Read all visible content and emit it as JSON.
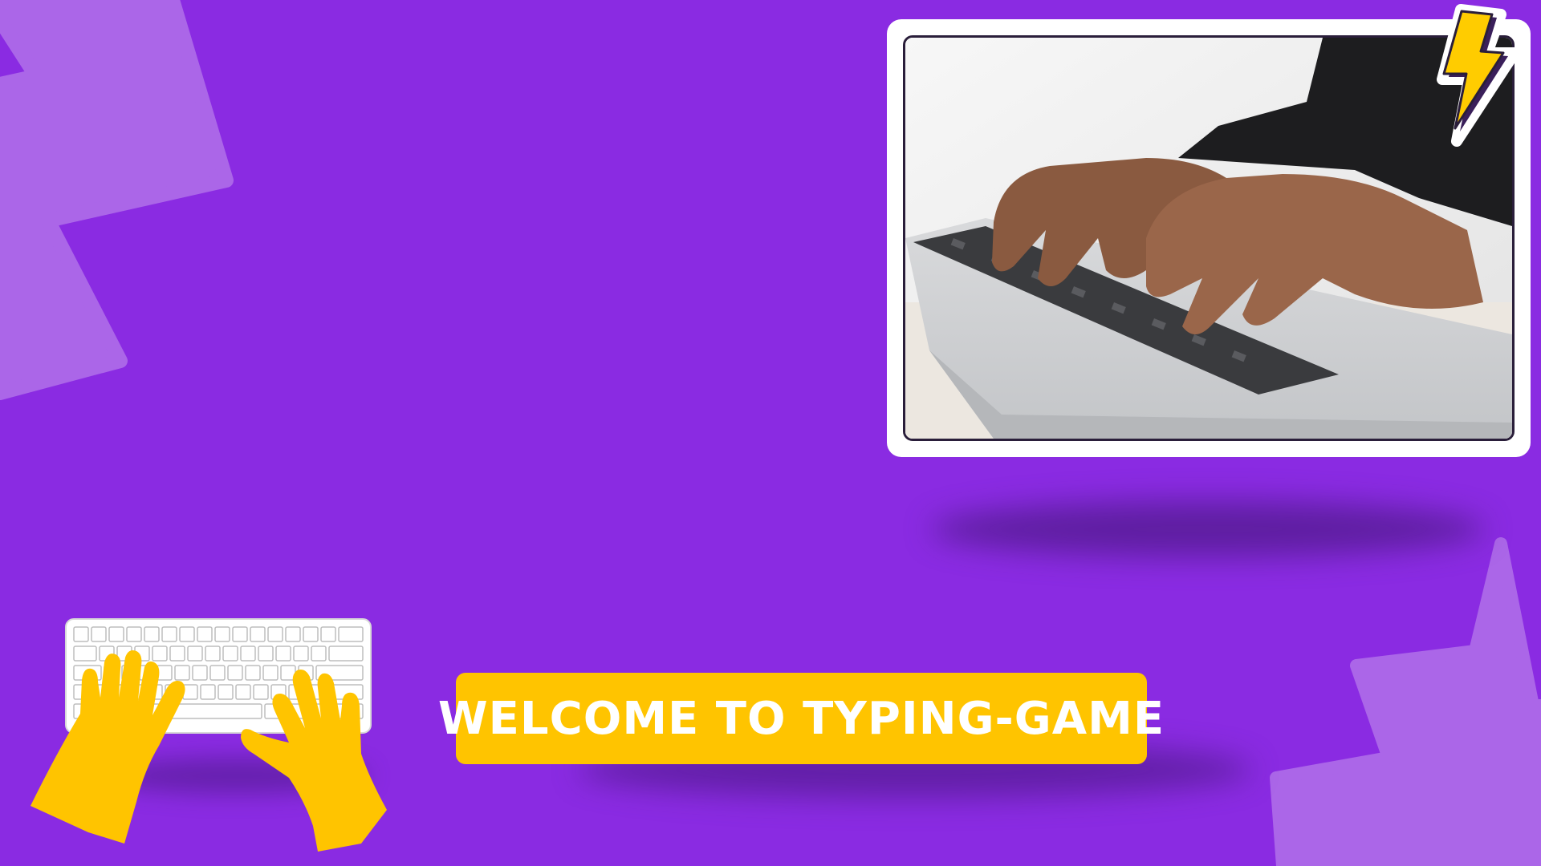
{
  "banner": {
    "title": "WELCOME TO TYPING-GAME"
  },
  "colors": {
    "background": "#8a2be2",
    "decor_zigzag": "#ab66e8",
    "banner": "#ffc400",
    "banner_text": "#ffffff",
    "hands": "#ffc400",
    "lightning": "#ffcc00"
  },
  "icons": {
    "hero_photo": "hands-typing-on-laptop-photo",
    "badge": "lightning-bolt-icon",
    "illustration": "keyboard-with-hands-illustration"
  }
}
